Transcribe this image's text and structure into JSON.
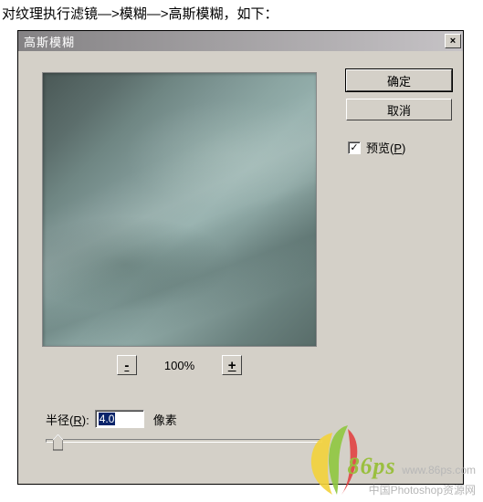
{
  "caption": "对纹理执行滤镜—>模糊—>高斯模糊，如下：",
  "dialog": {
    "title": "高斯模糊",
    "close": "×",
    "zoom_minus": "-",
    "zoom_plus": "+",
    "zoom_level": "100%",
    "radius_label_pre": "半径(",
    "radius_label_u": "R",
    "radius_label_post": "):",
    "radius_value": "4.0",
    "radius_unit": "像素",
    "ok_label": "确定",
    "cancel_label": "取消",
    "preview_check": "✓",
    "preview_label_pre": "预览(",
    "preview_label_u": "P",
    "preview_label_post": ")"
  },
  "watermark": {
    "brand": "86ps",
    "domain": "www.86ps.com",
    "tagline": "中国Photoshop资源网"
  }
}
